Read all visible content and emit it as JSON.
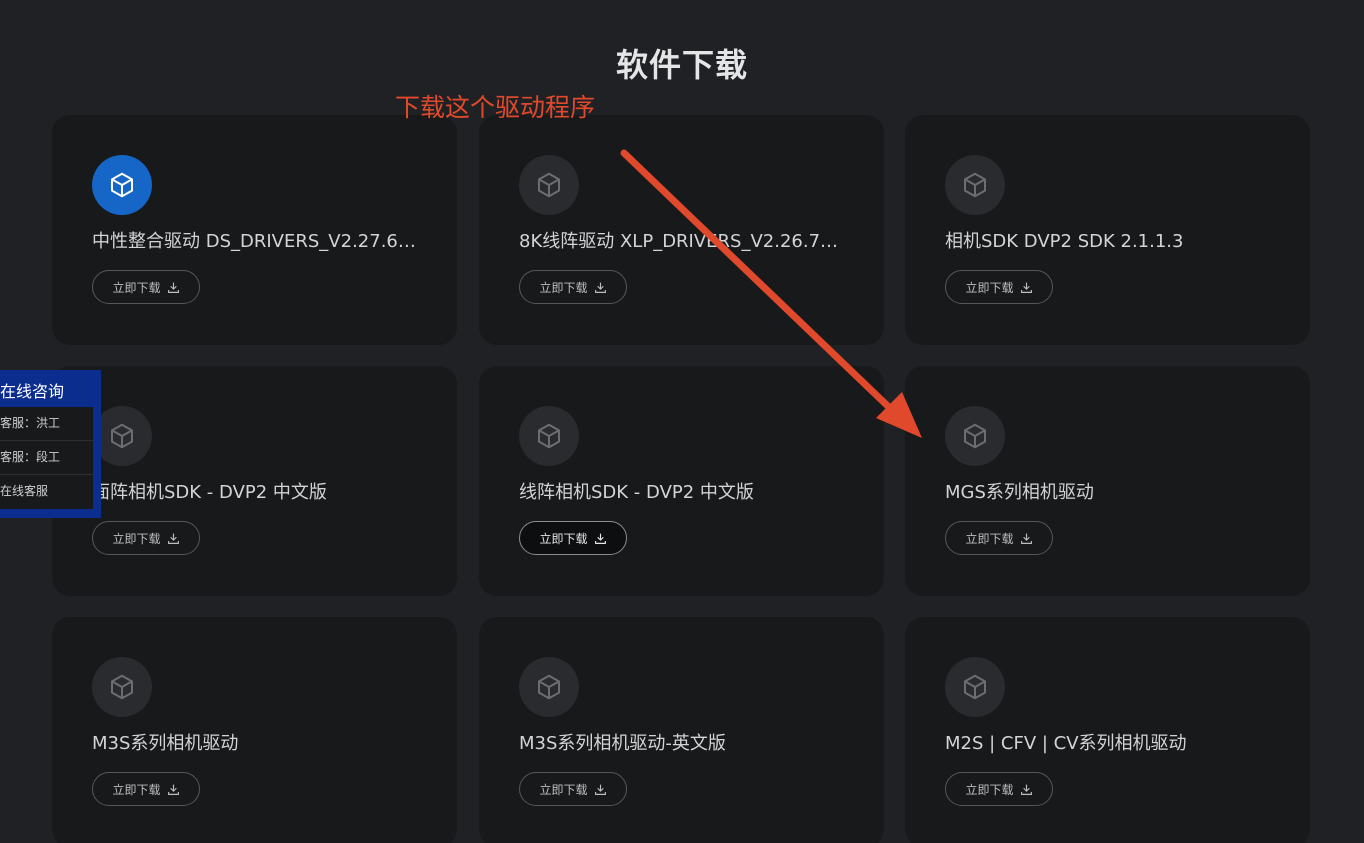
{
  "page": {
    "title": "软件下载"
  },
  "annotation": {
    "text": "下载这个驱动程序",
    "color": "#e0492b"
  },
  "cards": [
    {
      "name": "中性整合驱动 DS_DRIVERS_V2.27.6…",
      "button": "立即下载",
      "icon": "cube-icon",
      "active": true
    },
    {
      "name": "8K线阵驱动 XLP_DRIVERS_V2.26.7…",
      "button": "立即下载",
      "icon": "cube-icon"
    },
    {
      "name": "相机SDK DVP2 SDK 2.1.1.3",
      "button": "立即下载",
      "icon": "cube-icon"
    },
    {
      "name": "面阵相机SDK - DVP2 中文版",
      "button": "立即下载",
      "icon": "cube-icon"
    },
    {
      "name": "线阵相机SDK - DVP2 中文版",
      "button": "立即下载",
      "icon": "cube-icon",
      "hover": true
    },
    {
      "name": "MGS系列相机驱动",
      "button": "立即下载",
      "icon": "cube-icon"
    },
    {
      "name": "M3S系列相机驱动",
      "button": "立即下载",
      "icon": "cube-icon"
    },
    {
      "name": "M3S系列相机驱动-英文版",
      "button": "立即下载",
      "icon": "cube-icon"
    },
    {
      "name": "M2S | CFV | CV系列相机驱动",
      "button": "立即下载",
      "icon": "cube-icon"
    }
  ],
  "chat": {
    "title": "在线咨询",
    "items": [
      "客服：洪工",
      "客服：段工",
      "在线客服"
    ]
  },
  "colors": {
    "background": "#202124",
    "card": "#17191b",
    "accent": "#1566c6",
    "chat_panel": "#0b2d8e"
  }
}
